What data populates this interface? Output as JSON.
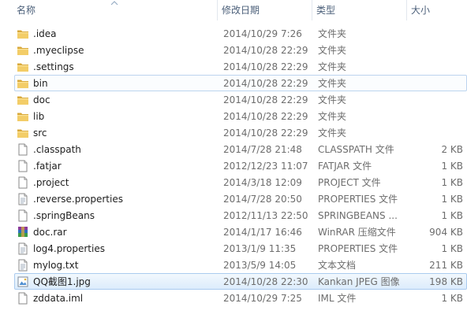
{
  "columns": {
    "name": "名称",
    "date": "修改日期",
    "type": "类型",
    "size": "大小"
  },
  "files": [
    {
      "name": ".idea",
      "date": "2014/10/29 7:26",
      "type": "文件夹",
      "size": "",
      "icon": "folder-icon",
      "state": ""
    },
    {
      "name": ".myeclipse",
      "date": "2014/10/28 22:29",
      "type": "文件夹",
      "size": "",
      "icon": "folder-icon",
      "state": ""
    },
    {
      "name": ".settings",
      "date": "2014/10/28 22:29",
      "type": "文件夹",
      "size": "",
      "icon": "folder-icon",
      "state": ""
    },
    {
      "name": "bin",
      "date": "2014/10/28 22:29",
      "type": "文件夹",
      "size": "",
      "icon": "folder-icon",
      "state": "hover"
    },
    {
      "name": "doc",
      "date": "2014/10/28 22:29",
      "type": "文件夹",
      "size": "",
      "icon": "folder-icon",
      "state": ""
    },
    {
      "name": "lib",
      "date": "2014/10/28 22:29",
      "type": "文件夹",
      "size": "",
      "icon": "folder-icon",
      "state": ""
    },
    {
      "name": "src",
      "date": "2014/10/28 22:29",
      "type": "文件夹",
      "size": "",
      "icon": "folder-icon",
      "state": ""
    },
    {
      "name": ".classpath",
      "date": "2014/7/28 21:48",
      "type": "CLASSPATH 文件",
      "size": "2 KB",
      "icon": "file-icon",
      "state": ""
    },
    {
      "name": ".fatjar",
      "date": "2012/12/23 11:07",
      "type": "FATJAR 文件",
      "size": "1 KB",
      "icon": "file-icon",
      "state": ""
    },
    {
      "name": ".project",
      "date": "2014/3/18 12:09",
      "type": "PROJECT 文件",
      "size": "1 KB",
      "icon": "file-icon",
      "state": ""
    },
    {
      "name": ".reverse.properties",
      "date": "2014/7/28 20:50",
      "type": "PROPERTIES 文件",
      "size": "1 KB",
      "icon": "text-file-icon",
      "state": ""
    },
    {
      "name": ".springBeans",
      "date": "2012/11/13 22:50",
      "type": "SPRINGBEANS ...",
      "size": "1 KB",
      "icon": "file-icon",
      "state": ""
    },
    {
      "name": "doc.rar",
      "date": "2014/1/17 16:46",
      "type": "WinRAR 压缩文件",
      "size": "904 KB",
      "icon": "rar-archive-icon",
      "state": ""
    },
    {
      "name": "log4.properties",
      "date": "2013/1/9 11:35",
      "type": "PROPERTIES 文件",
      "size": "1 KB",
      "icon": "text-file-icon",
      "state": ""
    },
    {
      "name": "mylog.txt",
      "date": "2013/5/9 14:05",
      "type": "文本文档",
      "size": "211 KB",
      "icon": "text-file-icon",
      "state": ""
    },
    {
      "name": "QQ截图1.jpg",
      "date": "2014/10/28 22:30",
      "type": "Kankan JPEG 图像",
      "size": "198 KB",
      "icon": "image-file-icon",
      "state": "selected"
    },
    {
      "name": "zddata.iml",
      "date": "2014/10/29 7:25",
      "type": "IML 文件",
      "size": "1 KB",
      "icon": "file-icon",
      "state": ""
    }
  ],
  "colors": {
    "selection": "#dcecfc",
    "selection_border": "#aacbef",
    "header_text": "#4c607a",
    "folder": "#f0c75e"
  }
}
